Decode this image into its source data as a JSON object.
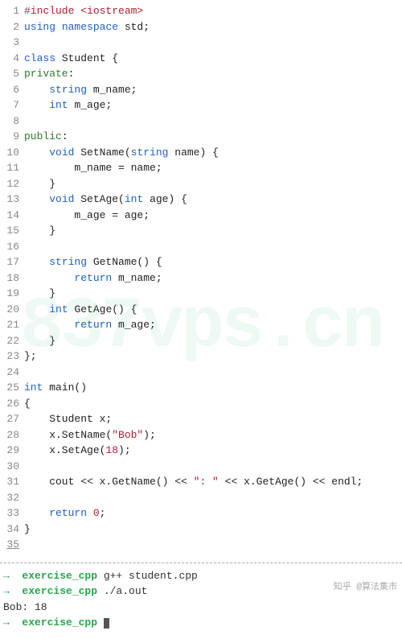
{
  "code": {
    "lines": [
      {
        "n": 1,
        "tokens": [
          {
            "t": "#include ",
            "c": "kw-pp"
          },
          {
            "t": "<iostream>",
            "c": "angle"
          }
        ]
      },
      {
        "n": 2,
        "tokens": [
          {
            "t": "using ",
            "c": "kw-blue"
          },
          {
            "t": "namespace ",
            "c": "kw-blue"
          },
          {
            "t": "std;",
            "c": "ident"
          }
        ]
      },
      {
        "n": 3,
        "tokens": [
          {
            "t": "",
            "c": "ident"
          }
        ]
      },
      {
        "n": 4,
        "tokens": [
          {
            "t": "class ",
            "c": "kw-blue"
          },
          {
            "t": "Student {",
            "c": "ident"
          }
        ]
      },
      {
        "n": 5,
        "tokens": [
          {
            "t": "private",
            "c": "kw-grn"
          },
          {
            "t": ":",
            "c": "ident"
          }
        ]
      },
      {
        "n": 6,
        "tokens": [
          {
            "t": "    ",
            "c": "ident"
          },
          {
            "t": "string ",
            "c": "kw-blue"
          },
          {
            "t": "m_name;",
            "c": "ident"
          }
        ]
      },
      {
        "n": 7,
        "tokens": [
          {
            "t": "    ",
            "c": "ident"
          },
          {
            "t": "int ",
            "c": "kw-blue"
          },
          {
            "t": "m_age;",
            "c": "ident"
          }
        ]
      },
      {
        "n": 8,
        "tokens": [
          {
            "t": "",
            "c": "ident"
          }
        ]
      },
      {
        "n": 9,
        "tokens": [
          {
            "t": "public",
            "c": "kw-grn"
          },
          {
            "t": ":",
            "c": "ident"
          }
        ]
      },
      {
        "n": 10,
        "tokens": [
          {
            "t": "    ",
            "c": "ident"
          },
          {
            "t": "void ",
            "c": "kw-blue"
          },
          {
            "t": "SetName(",
            "c": "ident"
          },
          {
            "t": "string ",
            "c": "kw-blue"
          },
          {
            "t": "name) {",
            "c": "ident"
          }
        ]
      },
      {
        "n": 11,
        "tokens": [
          {
            "t": "        m_name = name;",
            "c": "ident"
          }
        ]
      },
      {
        "n": 12,
        "tokens": [
          {
            "t": "    }",
            "c": "ident"
          }
        ]
      },
      {
        "n": 13,
        "tokens": [
          {
            "t": "    ",
            "c": "ident"
          },
          {
            "t": "void ",
            "c": "kw-blue"
          },
          {
            "t": "SetAge(",
            "c": "ident"
          },
          {
            "t": "int ",
            "c": "kw-blue"
          },
          {
            "t": "age) {",
            "c": "ident"
          }
        ]
      },
      {
        "n": 14,
        "tokens": [
          {
            "t": "        m_age = age;",
            "c": "ident"
          }
        ]
      },
      {
        "n": 15,
        "tokens": [
          {
            "t": "    }",
            "c": "ident"
          }
        ]
      },
      {
        "n": 16,
        "tokens": [
          {
            "t": "",
            "c": "ident"
          }
        ]
      },
      {
        "n": 17,
        "tokens": [
          {
            "t": "    ",
            "c": "ident"
          },
          {
            "t": "string ",
            "c": "kw-blue"
          },
          {
            "t": "GetName() {",
            "c": "ident"
          }
        ]
      },
      {
        "n": 18,
        "tokens": [
          {
            "t": "        ",
            "c": "ident"
          },
          {
            "t": "return ",
            "c": "kw-blue"
          },
          {
            "t": "m_name;",
            "c": "ident"
          }
        ]
      },
      {
        "n": 19,
        "tokens": [
          {
            "t": "    }",
            "c": "ident"
          }
        ]
      },
      {
        "n": 20,
        "tokens": [
          {
            "t": "    ",
            "c": "ident"
          },
          {
            "t": "int ",
            "c": "kw-blue"
          },
          {
            "t": "GetAge() {",
            "c": "ident"
          }
        ]
      },
      {
        "n": 21,
        "tokens": [
          {
            "t": "        ",
            "c": "ident"
          },
          {
            "t": "return ",
            "c": "kw-blue"
          },
          {
            "t": "m_age;",
            "c": "ident"
          }
        ]
      },
      {
        "n": 22,
        "tokens": [
          {
            "t": "    }",
            "c": "ident"
          }
        ]
      },
      {
        "n": 23,
        "tokens": [
          {
            "t": "};",
            "c": "ident"
          }
        ]
      },
      {
        "n": 24,
        "tokens": [
          {
            "t": "",
            "c": "ident"
          }
        ]
      },
      {
        "n": 25,
        "tokens": [
          {
            "t": "int ",
            "c": "kw-blue"
          },
          {
            "t": "main()",
            "c": "ident"
          }
        ]
      },
      {
        "n": 26,
        "tokens": [
          {
            "t": "{",
            "c": "ident"
          }
        ]
      },
      {
        "n": 27,
        "tokens": [
          {
            "t": "    Student x;",
            "c": "ident"
          }
        ]
      },
      {
        "n": 28,
        "tokens": [
          {
            "t": "    x.SetName(",
            "c": "ident"
          },
          {
            "t": "\"Bob\"",
            "c": "str"
          },
          {
            "t": ");",
            "c": "ident"
          }
        ]
      },
      {
        "n": 29,
        "tokens": [
          {
            "t": "    x.SetAge(",
            "c": "ident"
          },
          {
            "t": "18",
            "c": "num"
          },
          {
            "t": ");",
            "c": "ident"
          }
        ]
      },
      {
        "n": 30,
        "tokens": [
          {
            "t": "",
            "c": "ident"
          }
        ]
      },
      {
        "n": 31,
        "tokens": [
          {
            "t": "    cout << x.GetName() << ",
            "c": "ident"
          },
          {
            "t": "\": \"",
            "c": "str"
          },
          {
            "t": " << x.GetAge() << endl;",
            "c": "ident"
          }
        ]
      },
      {
        "n": 32,
        "tokens": [
          {
            "t": "",
            "c": "ident"
          }
        ]
      },
      {
        "n": 33,
        "tokens": [
          {
            "t": "    ",
            "c": "ident"
          },
          {
            "t": "return ",
            "c": "kw-blue"
          },
          {
            "t": "0",
            "c": "num"
          },
          {
            "t": ";",
            "c": "ident"
          }
        ]
      },
      {
        "n": 34,
        "tokens": [
          {
            "t": "}",
            "c": "ident"
          }
        ]
      },
      {
        "n": 35,
        "tokens": [
          {
            "t": "",
            "c": "ident"
          }
        ],
        "current": true
      }
    ]
  },
  "terminal": {
    "prompt_arrow": "→",
    "prompt_dir": "exercise_cpp",
    "lines": [
      {
        "type": "prompt",
        "cmd": "g++ student.cpp"
      },
      {
        "type": "prompt",
        "cmd": "./a.out"
      },
      {
        "type": "output",
        "text": "Bob: 18"
      },
      {
        "type": "prompt",
        "cmd": "",
        "cursor": true
      }
    ]
  },
  "watermark": "837vps.cn",
  "attribution": "知乎 @算法集市"
}
